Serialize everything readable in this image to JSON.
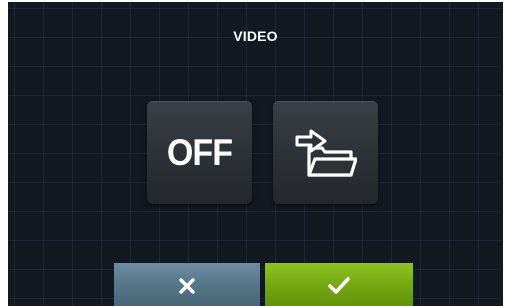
{
  "header": {
    "title": "VIDEO"
  },
  "controls": {
    "off_label": "OFF",
    "folder_icon": "folder-import-icon"
  },
  "footer": {
    "cancel_icon": "close-icon",
    "confirm_icon": "check-icon"
  },
  "colors": {
    "background": "#121922",
    "tile": "#2c3037",
    "cancel": "#557588",
    "confirm": "#74a812",
    "text": "#ffffff"
  }
}
